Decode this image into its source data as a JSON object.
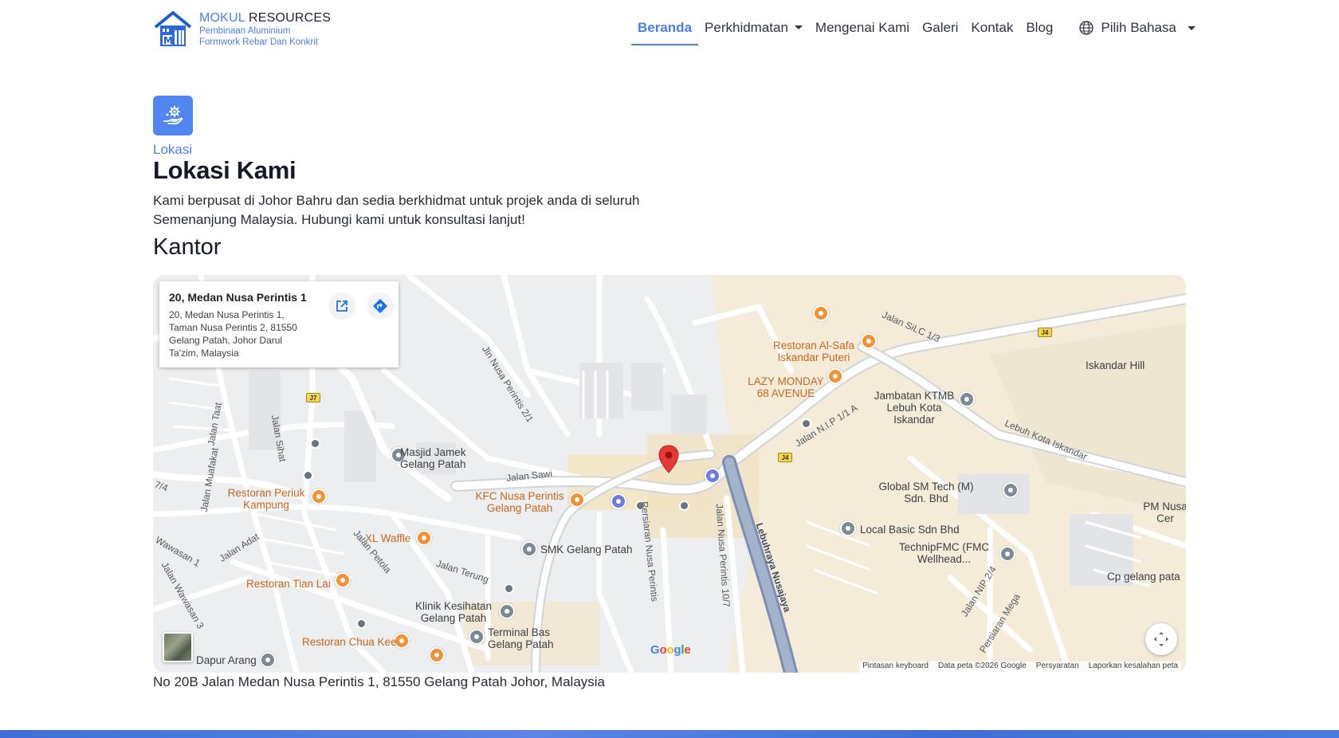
{
  "brand": {
    "name_accent": "MOKUL",
    "name_rest": "RESOURCES",
    "tagline_1": "Pembinaan Aluminium",
    "tagline_2": "Formwork Rebar Dan Konkrit"
  },
  "nav": {
    "items": [
      {
        "label": "Beranda"
      },
      {
        "label": "Perkhidmatan"
      },
      {
        "label": "Mengenai Kami"
      },
      {
        "label": "Galeri"
      },
      {
        "label": "Kontak"
      },
      {
        "label": "Blog"
      }
    ],
    "language": "Pilih Bahasa"
  },
  "section": {
    "eyebrow": "Lokasi",
    "title": "Lokasi Kami",
    "lead": "Kami berpusat di Johor Bahru dan sedia berkhidmat untuk projek anda di seluruh Semenanjung Malaysia. Hubungi kami untuk konsultasi lanjut!",
    "subtitle": "Kantor",
    "address": "No 20B Jalan Medan Nusa Perintis 1, 81550 Gelang Patah Johor, Malaysia"
  },
  "map": {
    "card": {
      "title": "20, Medan Nusa Perintis 1",
      "address": "20, Medan Nusa Perintis 1, Taman Nusa Perintis 2, 81550 Gelang Patah, Johor Darul Ta'zim, Malaysia"
    },
    "labels": {
      "restoran_alsafa": "Restoran Al-Safa Iskandar Puteri",
      "lazy_monday": "LAZY MONDAY 68 AVENUE",
      "jambatan": "Jambatan KTMB Lebuh Kota Iskandar",
      "iskandar_hill": "Iskandar Hill",
      "masjid": "Masjid Jamek Gelang Patah",
      "restoran_periuk": "Restoran Periuk Kampung",
      "kfc": "KFC Nusa Perintis Gelang Patah",
      "xl_waffle": "XL Waffle",
      "smk": "SMK Gelang Patah",
      "global_sm": "Global SM Tech (M) Sdn. Bhd",
      "local_basic": "Local Basic Sdn Bhd",
      "technip": "TechnipFMC (FMC Wellhead...",
      "pm_nusa": "PM Nusa Cer",
      "cp_gelang": "Cp gelang pata",
      "restoran_tian": "Restoran Tian Lai",
      "klinik": "Klinik Kesihatan Gelang Patah",
      "terminal": "Terminal Bas Gelang Patah",
      "restoran_chua": "Restoran Chua Kee",
      "dapur_arang": "Dapur Arang"
    },
    "roads": {
      "jalan_silc": "Jalan SiLC 1/3",
      "jln_nusa_perintis": "Jln Nusa Perintis 2/1",
      "jalan_taat": "Jalan Taat",
      "jalan_sihat": "Jalan Sihat",
      "jalan_muafakat": "Jalan Muafakat",
      "jalan_sawi": "Jalan Sawi",
      "jalan_nip": "Jalan N.I.P 1/1 A",
      "lebuh_kota": "Lebuh Kota Iskandar",
      "jalan_adat": "Jalan Adat",
      "jalan_petola": "Jalan Petola",
      "jalan_terung": "Jalan Terung",
      "persiaran_nusa": "Persiaran Nusa Perintis",
      "jalan_nusa_10": "Jalan Nusa Perintis 10/7",
      "lebuhraya": "Lebuhraya Nusajaya",
      "jalan_nip24": "Jalan NIP 2/4",
      "persiaran_mega": "Persiaran Mega",
      "wawasan": "Wawasan 1",
      "jalan_wawasan3": "Jalan Wawasan 3",
      "r74": "7/4"
    },
    "shields": {
      "j4": "J4",
      "j7": "J7"
    },
    "google": "Google",
    "attribution": [
      "Pintasan keyboard",
      "Data peta ©2026 Google",
      "Persyaratan",
      "Laporkan kesalahan peta"
    ]
  },
  "colors": {
    "accent": "#4a7fe6",
    "icon_bg": "#4f86f0",
    "marker_red": "#e53935",
    "poi_orange": "#f29233"
  },
  "icons": [
    "house-logo-icon",
    "settings-hand-icon",
    "globe-icon",
    "open-external-icon",
    "directions-icon",
    "fullscreen-icon",
    "map-pin-icon"
  ]
}
